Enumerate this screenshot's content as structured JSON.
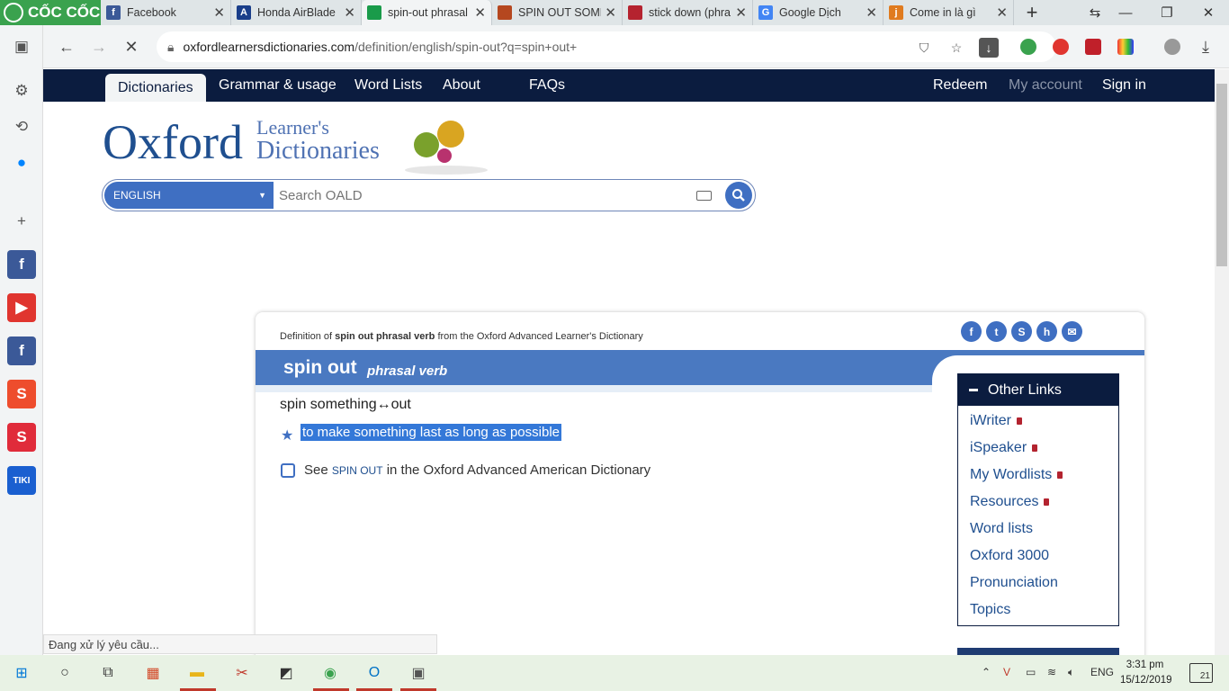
{
  "browser": {
    "brand": "CỐC CỐC",
    "tabs": [
      {
        "label": "Facebook",
        "favicon": "facebook-icon",
        "color": "#3b5998"
      },
      {
        "label": "Honda AirBlade",
        "favicon": "ab-icon",
        "color": "#1a3e8a"
      },
      {
        "label": "spin-out phrasal",
        "favicon": "oxford-flag-icon",
        "color": "#1a9b4a",
        "active": true
      },
      {
        "label": "SPIN OUT SOME",
        "favicon": "cambridge-icon",
        "color": "#b5471f"
      },
      {
        "label": "stick down (phra",
        "favicon": "book-icon",
        "color": "#b5232f"
      },
      {
        "label": "Google Dịch",
        "favicon": "google-translate-icon",
        "color": "#4285f4"
      },
      {
        "label": "Come in là gì",
        "favicon": "j-icon",
        "color": "#e07b1f"
      }
    ],
    "url_host": "oxfordlearnersdictionaries.com",
    "url_path": "/definition/english/spin-out?q=spin+out+"
  },
  "site_nav": {
    "left": [
      "Dictionaries",
      "Grammar & usage",
      "Word Lists",
      "About",
      "FAQs"
    ],
    "right": [
      "Redeem",
      "My account",
      "Sign in"
    ]
  },
  "logo": {
    "oxford": "Oxford",
    "line1": "Learner's",
    "line2": "Dictionaries"
  },
  "search": {
    "language": "ENGLISH",
    "placeholder": "Search OALD"
  },
  "entry": {
    "definition_of_prefix": "Definition of ",
    "definition_of_bold": "spin out phrasal verb",
    "definition_of_suffix": " from the Oxford Advanced Learner's Dictionary",
    "headword": "spin out",
    "pos": "phrasal verb",
    "phrasal": "spin something↔out",
    "definition": "to make something last as long as possible",
    "see_prefix": "See ",
    "see_link": "SPIN OUT",
    "see_suffix": " in the Oxford Advanced American Dictionary"
  },
  "share_icons": [
    "facebook-icon",
    "twitter-icon",
    "stumbleupon-icon",
    "hi5-icon",
    "email-icon"
  ],
  "other_links": {
    "title": "Other Links",
    "items": [
      {
        "label": "iWriter",
        "locked": true
      },
      {
        "label": "iSpeaker",
        "locked": true
      },
      {
        "label": "My Wordlists",
        "locked": true
      },
      {
        "label": "Resources",
        "locked": true
      },
      {
        "label": "Word lists",
        "locked": false
      },
      {
        "label": "Oxford 3000",
        "locked": false
      },
      {
        "label": "Pronunciation",
        "locked": false
      },
      {
        "label": "Topics",
        "locked": false
      }
    ]
  },
  "status_bar": "Đang xử lý yêu cầu...",
  "taskbar": {
    "lang": "ENG",
    "time": "3:31 pm",
    "date": "15/12/2019",
    "notifications": "21"
  },
  "colors": {
    "nav_dark": "#0b1c3f",
    "accent_blue": "#4a79c1",
    "link": "#1f4f8f",
    "selection": "#3478d8"
  }
}
